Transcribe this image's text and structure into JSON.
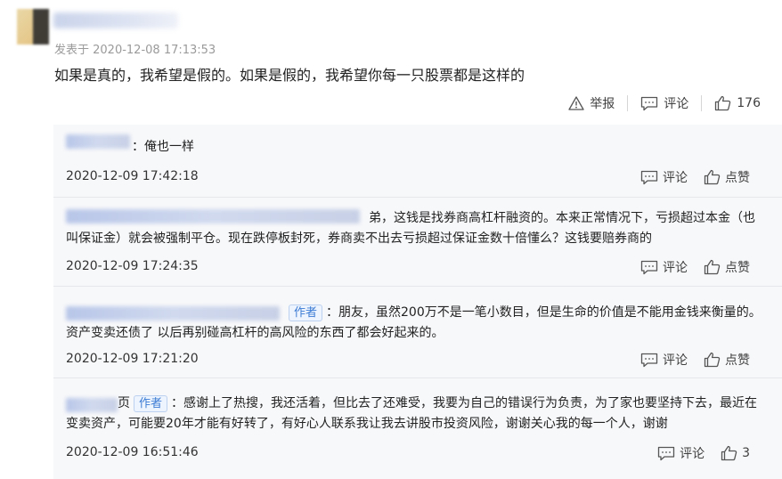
{
  "post": {
    "time": "发表于 2020-12-08 17:13:53",
    "content": "如果是真的，我希望是假的。如果是假的，我希望你每一只股票都是这样的",
    "actions": {
      "report": "举报",
      "comment": "评论",
      "likes": "176"
    }
  },
  "replies": [
    {
      "text": "：俺也一样",
      "time": "2020-12-09 17:42:18",
      "comment": "评论",
      "like": "点赞"
    },
    {
      "text": "弟，这钱是找券商高杠杆融资的。本来正常情况下，亏损超过本金（也叫保证金）就会被强制平仓。现在跌停板封死，券商卖不出去亏损超过保证金数十倍懂么？这钱要赔券商的",
      "time": "2020-12-09 17:24:35",
      "comment": "评论",
      "like": "点赞"
    },
    {
      "author_tag": "作者",
      "text": "：朋友，虽然200万不是一笔小数目，但是生命的价值是不能用金钱来衡量的。资产变卖还债了 以后再别碰高杠杆的高风险的东西了都会好起来的。",
      "time": "2020-12-09 17:21:20",
      "comment": "评论",
      "like": "点赞"
    },
    {
      "name_suffix": "页",
      "author_tag": "作者",
      "text": "：感谢上了热搜，我还活着，但比去了还难受，我要为自己的错误行为负责，为了家也要坚持下去，最近在变卖资产，可能要20年才能有好转了，有好心人联系我让我去讲股市投资风险，谢谢关心我的每一个人，谢谢",
      "time": "2020-12-09 16:51:46",
      "comment": "评论",
      "likes": "3"
    }
  ],
  "icons": {
    "report": "warning-triangle-icon",
    "comment": "comment-bubble-icon",
    "like": "thumbs-up-icon"
  }
}
